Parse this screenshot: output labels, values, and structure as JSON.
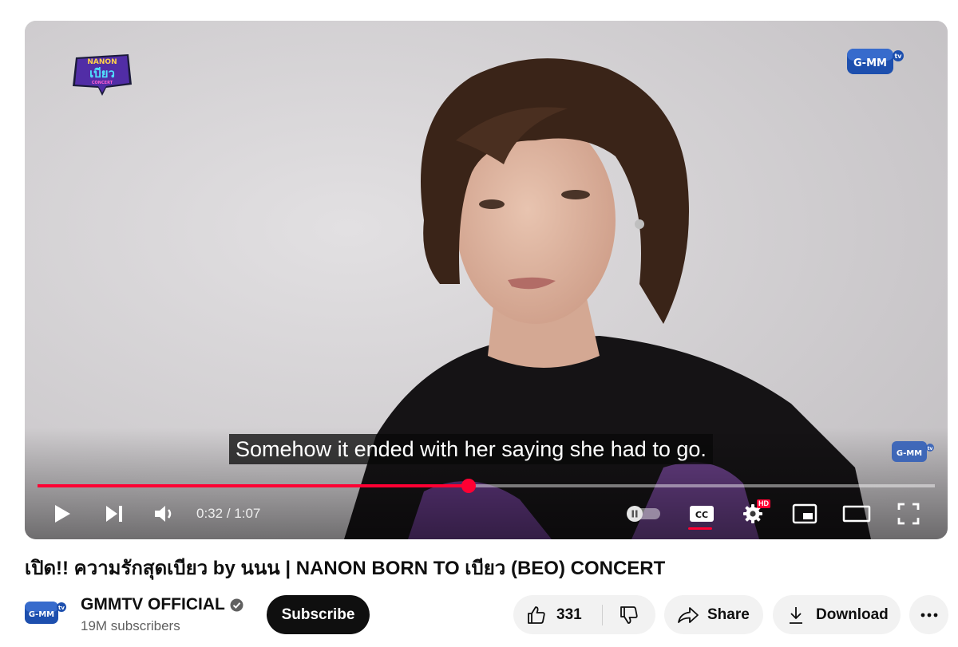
{
  "player": {
    "caption": "Somehow it ended with her saying she had to go.",
    "show_logo": {
      "line1": "NANON",
      "line2": "เบียว",
      "line3": "CONCERT"
    },
    "brand_logo": "G-MM",
    "brand_logo_sub": "tv",
    "progress_fraction": 0.48,
    "time_current": "0:32",
    "time_separator": " / ",
    "time_total": "1:07",
    "hd_badge": "HD",
    "cc_label": "CC",
    "accent_color": "#ff0033",
    "icons": [
      "play-icon",
      "next-icon",
      "volume-icon",
      "autoplay-toggle-icon",
      "captions-icon",
      "settings-icon",
      "miniplayer-icon",
      "theater-mode-icon",
      "fullscreen-icon"
    ]
  },
  "video": {
    "title": "เปิด!! ความรักสุดเบียว by นนน | NANON BORN TO เบียว (BEO) CONCERT"
  },
  "channel": {
    "name": "GMMTV OFFICIAL",
    "subscribers": "19M subscribers",
    "subscribe_label": "Subscribe"
  },
  "actions": {
    "like_count": "331",
    "share_label": "Share",
    "download_label": "Download"
  }
}
